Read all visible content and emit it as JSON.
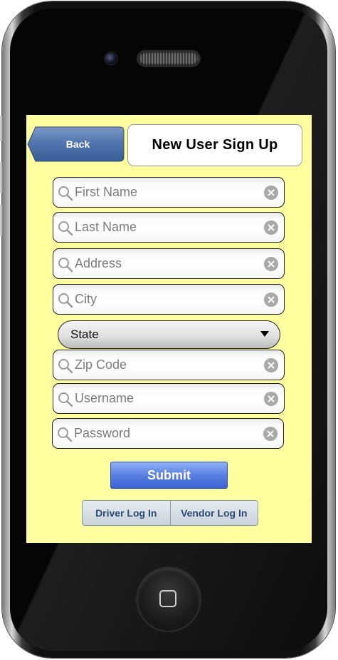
{
  "header": {
    "back_label": "Back",
    "title": "New User Sign Up"
  },
  "form": {
    "fields": [
      {
        "placeholder": "First Name",
        "value": ""
      },
      {
        "placeholder": "Last Name",
        "value": ""
      },
      {
        "placeholder": "Address",
        "value": ""
      },
      {
        "placeholder": "City",
        "value": ""
      },
      {
        "placeholder": "Zip Code",
        "value": ""
      },
      {
        "placeholder": "Username",
        "value": ""
      },
      {
        "placeholder": "Password",
        "value": ""
      }
    ],
    "state_select": {
      "selected": "State"
    },
    "submit_label": "Submit"
  },
  "login_tabs": [
    "Driver Log In",
    "Vendor Log In"
  ],
  "icons": {
    "field_leading": "search-icon",
    "field_trailing": "clear-icon",
    "select_arrow": "triangle-down-icon",
    "home": "home-button-icon"
  },
  "colors": {
    "screen_background": "#ffffa0",
    "back_button": "#4a6ea8",
    "submit_button": "#4a70dc",
    "tab_text": "#2c4a73"
  }
}
